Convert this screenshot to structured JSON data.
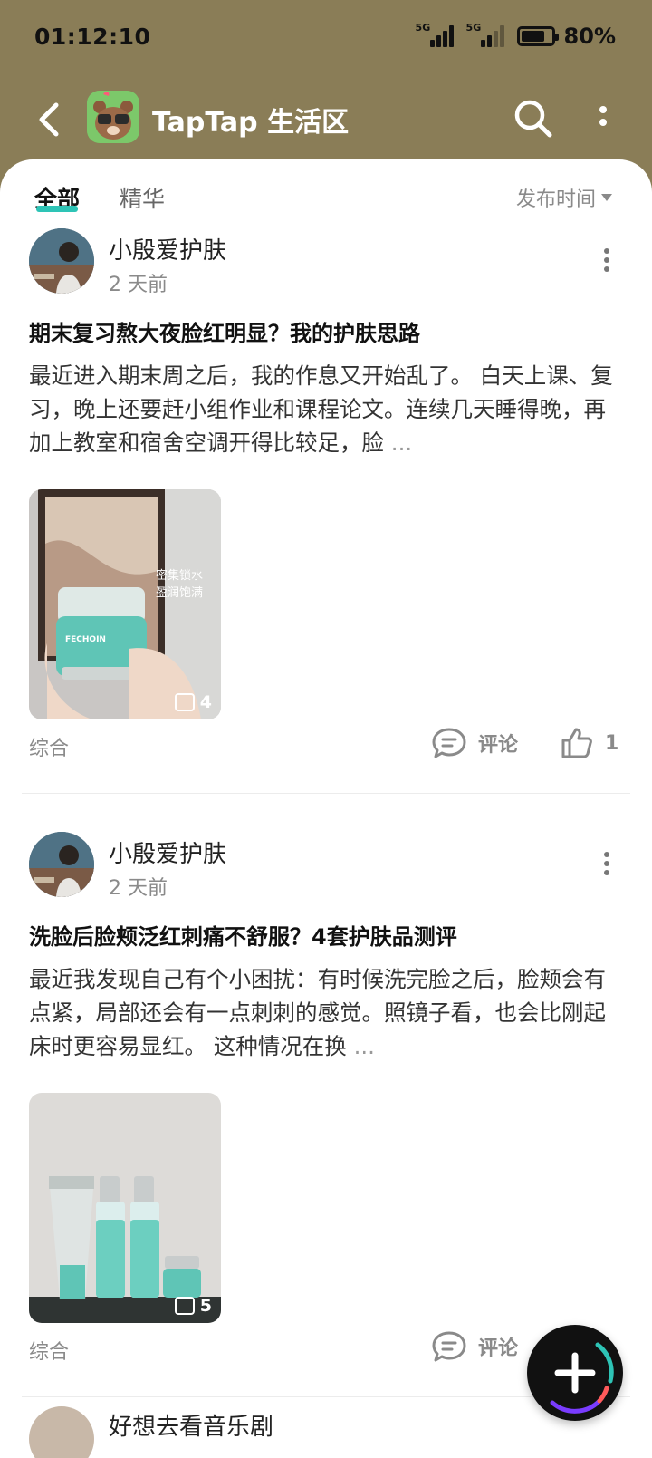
{
  "status_bar": {
    "time": "01:12:10",
    "signal1_label": "5G",
    "signal2_label": "5G",
    "battery": "80%"
  },
  "app_bar": {
    "title": "TapTap 生活区"
  },
  "tabs": [
    {
      "label": "全部",
      "active": true
    },
    {
      "label": "精华",
      "active": false
    }
  ],
  "sort": {
    "label": "发布时间"
  },
  "posts": [
    {
      "author": "小殷爱护肤",
      "time": "2 天前",
      "title": "期末复习熬大夜脸红明显？我的护肤思路",
      "body": "最近进入期末周之后，我的作息又开始乱了。 白天上课、复习，晚上还要赶小组作业和课程论文。连续几天睡得晚，再加上教室和宿舍空调开得比较足，脸",
      "ellipsis": "...",
      "image_text_line1": "密集锁水",
      "image_text_line2": "盈润饱满",
      "image_count": "4",
      "tag": "综合",
      "comment_label": "评论",
      "like_count": "1"
    },
    {
      "author": "小殷爱护肤",
      "time": "2 天前",
      "title": "洗脸后脸颊泛红刺痛不舒服？4套护肤品测评",
      "body": "最近我发现自己有个小困扰：有时候洗完脸之后，脸颊会有点紧，局部还会有一点刺刺的感觉。照镜子看，也会比刚起床时更容易显红。 这种情况在换",
      "ellipsis": "...",
      "image_count": "5",
      "tag": "综合",
      "comment_label": "评论"
    },
    {
      "author": "好想去看音乐剧"
    }
  ],
  "colors": {
    "header_bg": "#8a7d57",
    "accent": "#2ec4b6"
  }
}
